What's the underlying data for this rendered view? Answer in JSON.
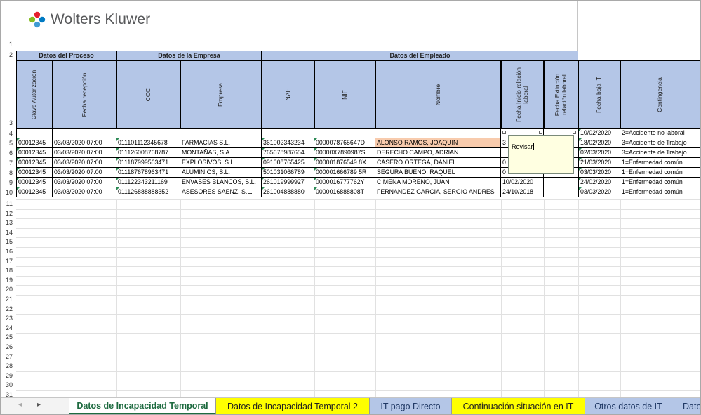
{
  "brand": {
    "name": "Wolters Kluwer",
    "logo_colors": [
      "#e5202e",
      "#85bc20",
      "#007ac3",
      "#409bd2"
    ]
  },
  "header_groups": [
    "Datos del Proceso",
    "Datos de la Empresa",
    "Datos del Empleado"
  ],
  "columns": [
    "Clave Autorización",
    "Fecha recepción",
    "CCC",
    "Empresa",
    "NAF",
    "NIF",
    "Nombre",
    "Fecha Inicio relación laboral",
    "Fecha Extinción relación laboral",
    "Fecha baja IT",
    "Contingencia"
  ],
  "row4": {
    "fecha_baja": "10/02/2020",
    "contingencia": "2=Accidente no laboral"
  },
  "rows": [
    {
      "clave": "00012345",
      "fecha": "03/03/2020 07:00",
      "ccc": "01110111234567​8",
      "empresa": "FARMACIAS S.L.",
      "naf": "361002343234",
      "nif": "0000078765647D",
      "nombre": "ALONSO RAMOS, JOAQUIN",
      "inicio": "3",
      "extincion": "",
      "baja": "18/02/2020",
      "contingencia": "3=Accidente de Trabajo"
    },
    {
      "clave": "00012345",
      "fecha": "03/03/2020 07:00",
      "ccc": "011126008768787",
      "empresa": "MONTAÑAS, S.A.",
      "naf": "765678987654",
      "nif": "00000X7890987S",
      "nombre": "DERECHO CAMPO, ADRIAN",
      "inicio": "",
      "extincion": "",
      "baja": "02/03/2020",
      "contingencia": "3=Accidente de Trabajo"
    },
    {
      "clave": "00012345",
      "fecha": "03/03/2020 07:00",
      "ccc": "011187999563471",
      "empresa": "EXPLOSIVOS, S.L.",
      "naf": "091008765425",
      "nif": "000001876549 8X",
      "nombre": "CASERO ORTEGA, DANIEL",
      "inicio": "0",
      "extincion": "",
      "baja": "21/03/2020",
      "contingencia": "1=Enfermedad común"
    },
    {
      "clave": "00012345",
      "fecha": "03/03/2020 07:00",
      "ccc": "011187678963471",
      "empresa": "ALUMINIOS, S.L.",
      "naf": "501031066789",
      "nif": "000001666789 5R",
      "nombre": "SEGURA BUENO, RAQUEL",
      "inicio": "0",
      "extincion": "",
      "baja": "03/03/2020",
      "contingencia": "1=Enfermedad común"
    },
    {
      "clave": "00012345",
      "fecha": "03/03/2020 07:00",
      "ccc": "011122343211169",
      "empresa": "ENVASES BLANCOS, S.L.",
      "naf": "261019999927",
      "nif": "0000016777762Y",
      "nombre": "CIMENA MORENO, JUAN",
      "inicio": "10/02/2020",
      "extincion": "",
      "baja": "24/02/2020",
      "contingencia": "1=Enfermedad común"
    },
    {
      "clave": "00012345",
      "fecha": "03/03/2020 07:00",
      "ccc": "011126888888352",
      "empresa": "ASESORES SAENZ, S.L.",
      "naf": "261004888880",
      "nif": "0000016888808T",
      "nombre": "FERNANDEZ GARCIA, SERGIO ANDRES",
      "inicio": "24/10/2018",
      "extincion": "",
      "baja": "03/03/2020",
      "contingencia": "1=Enfermedad común"
    }
  ],
  "comment": {
    "text": "Revisar"
  },
  "row_numbers": [
    "1",
    "2",
    "3",
    "4",
    "5",
    "6",
    "7",
    "8",
    "9",
    "10",
    "11",
    "12",
    "13",
    "14",
    "15",
    "16",
    "17",
    "18",
    "19",
    "20",
    "21",
    "22",
    "23",
    "24",
    "25",
    "26",
    "27",
    "28",
    "29",
    "30",
    "31"
  ],
  "tabs": [
    {
      "label": "Datos de Incapacidad Temporal",
      "style": "active"
    },
    {
      "label": "Datos de Incapacidad Temporal 2",
      "style": "yellow"
    },
    {
      "label": "IT pago Directo",
      "style": "blue"
    },
    {
      "label": "Continuación situación en IT",
      "style": "yellow"
    },
    {
      "label": "Otros datos de IT",
      "style": "blue"
    },
    {
      "label": "Datc",
      "style": "blue"
    }
  ],
  "nav": {
    "prev": "◂",
    "next": "▸"
  }
}
